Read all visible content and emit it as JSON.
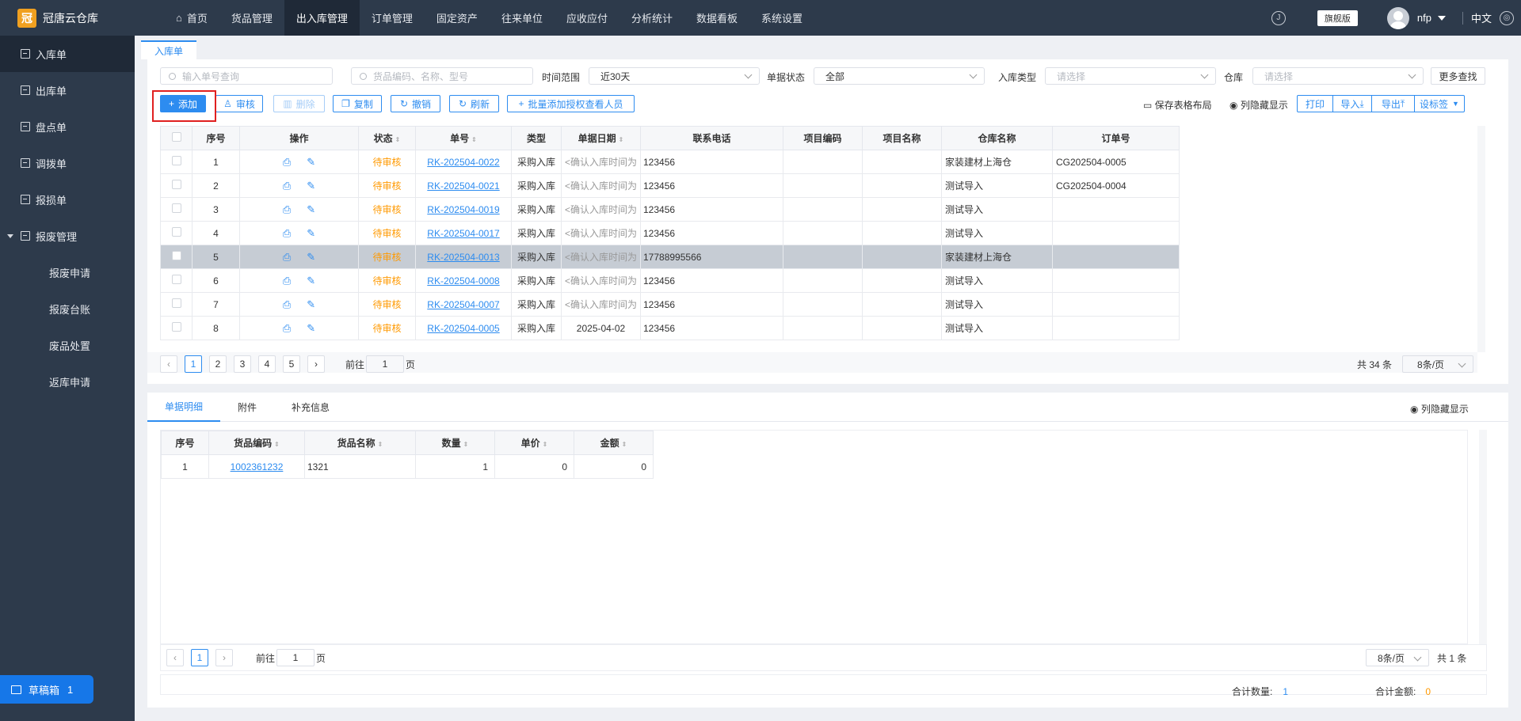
{
  "app": {
    "title": "冠唐云仓库",
    "logo_glyph": "冠"
  },
  "topnav": {
    "items": [
      {
        "label": "首页"
      },
      {
        "label": "货品管理"
      },
      {
        "label": "出入库管理"
      },
      {
        "label": "订单管理"
      },
      {
        "label": "固定资产"
      },
      {
        "label": "往来单位"
      },
      {
        "label": "应收应付"
      },
      {
        "label": "分析统计"
      },
      {
        "label": "数据看板"
      },
      {
        "label": "系统设置"
      }
    ],
    "edition": "旗舰版",
    "user": "nfp",
    "lang": "中文"
  },
  "sidebar": {
    "items": [
      {
        "label": "入库单"
      },
      {
        "label": "出库单"
      },
      {
        "label": "盘点单"
      },
      {
        "label": "调拨单"
      },
      {
        "label": "报损单"
      }
    ],
    "group": {
      "label": "报废管理",
      "children": [
        {
          "label": "报废申请"
        },
        {
          "label": "报废台账"
        },
        {
          "label": "废品处置"
        },
        {
          "label": "返库申请"
        }
      ]
    },
    "draft": {
      "label": "草稿箱",
      "count": "1"
    }
  },
  "tab": {
    "label": "入库单"
  },
  "filters": {
    "order_placeholder": "输入单号查询",
    "goods_placeholder": "货品编码、名称、型号",
    "time_label": "时间范围",
    "time_value": "近30天",
    "status_label": "单据状态",
    "status_value": "全部",
    "type_label": "入库类型",
    "type_placeholder": "请选择",
    "warehouse_label": "仓库",
    "warehouse_placeholder": "请选择",
    "more": "更多查找"
  },
  "toolbar": {
    "add": "添加",
    "audit": "审核",
    "delete": "删除",
    "copy": "复制",
    "revoke": "撤销",
    "refresh": "刷新",
    "batch_auth": "批量添加授权查看人员",
    "save_layout": "保存表格布局",
    "hide_cols": "列隐藏显示",
    "print": "打印",
    "import": "导入",
    "export": "导出",
    "set_tag": "设标签"
  },
  "main_table": {
    "headers": [
      "序号",
      "操作",
      "状态",
      "单号",
      "类型",
      "单据日期",
      "联系电话",
      "项目编码",
      "项目名称",
      "仓库名称",
      "订单号"
    ],
    "rows": [
      {
        "no": "1",
        "status": "待审核",
        "code": "RK-202504-0022",
        "type": "采购入库",
        "date": "<确认入库时间为",
        "phone": "123456",
        "pcode": "",
        "pname": "",
        "wh": "家装建材上海仓",
        "order": "CG202504-0005"
      },
      {
        "no": "2",
        "status": "待审核",
        "code": "RK-202504-0021",
        "type": "采购入库",
        "date": "<确认入库时间为",
        "phone": "123456",
        "pcode": "",
        "pname": "",
        "wh": "测试导入",
        "order": "CG202504-0004"
      },
      {
        "no": "3",
        "status": "待审核",
        "code": "RK-202504-0019",
        "type": "采购入库",
        "date": "<确认入库时间为",
        "phone": "123456",
        "pcode": "",
        "pname": "",
        "wh": "测试导入",
        "order": ""
      },
      {
        "no": "4",
        "status": "待审核",
        "code": "RK-202504-0017",
        "type": "采购入库",
        "date": "<确认入库时间为",
        "phone": "123456",
        "pcode": "",
        "pname": "",
        "wh": "测试导入",
        "order": ""
      },
      {
        "no": "5",
        "status": "待审核",
        "code": "RK-202504-0013",
        "type": "采购入库",
        "date": "<确认入库时间为",
        "phone": "17788995566",
        "pcode": "",
        "pname": "",
        "wh": "家装建材上海仓",
        "order": ""
      },
      {
        "no": "6",
        "status": "待审核",
        "code": "RK-202504-0008",
        "type": "采购入库",
        "date": "<确认入库时间为",
        "phone": "123456",
        "pcode": "",
        "pname": "",
        "wh": "测试导入",
        "order": ""
      },
      {
        "no": "7",
        "status": "待审核",
        "code": "RK-202504-0007",
        "type": "采购入库",
        "date": "<确认入库时间为",
        "phone": "123456",
        "pcode": "",
        "pname": "",
        "wh": "测试导入",
        "order": ""
      },
      {
        "no": "8",
        "status": "待审核",
        "code": "RK-202504-0005",
        "type": "采购入库",
        "date": "2025-04-02",
        "phone": "123456",
        "pcode": "",
        "pname": "",
        "wh": "测试导入",
        "order": ""
      }
    ]
  },
  "pager": {
    "pages": [
      "1",
      "2",
      "3",
      "4",
      "5"
    ],
    "goto_prefix": "前往",
    "goto_value": "1",
    "goto_suffix": "页",
    "total": "共 34 条",
    "size": "8条/页"
  },
  "detail": {
    "tabs": [
      "单据明细",
      "附件",
      "补充信息"
    ],
    "hide_cols": "列隐藏显示",
    "headers": [
      "序号",
      "货品编码",
      "货品名称",
      "数量",
      "单价",
      "金额"
    ],
    "rows": [
      {
        "no": "1",
        "code": "1002361232",
        "name": "1321",
        "qty": "1",
        "price": "0",
        "amount": "0"
      }
    ],
    "pager": {
      "page": "1",
      "goto_prefix": "前往",
      "goto_value": "1",
      "goto_suffix": "页",
      "size": "8条/页",
      "total": "共 1 条"
    },
    "sum_qty_label": "合计数量:",
    "sum_qty": "1",
    "sum_amt_label": "合计金额:",
    "sum_amt": "0"
  }
}
